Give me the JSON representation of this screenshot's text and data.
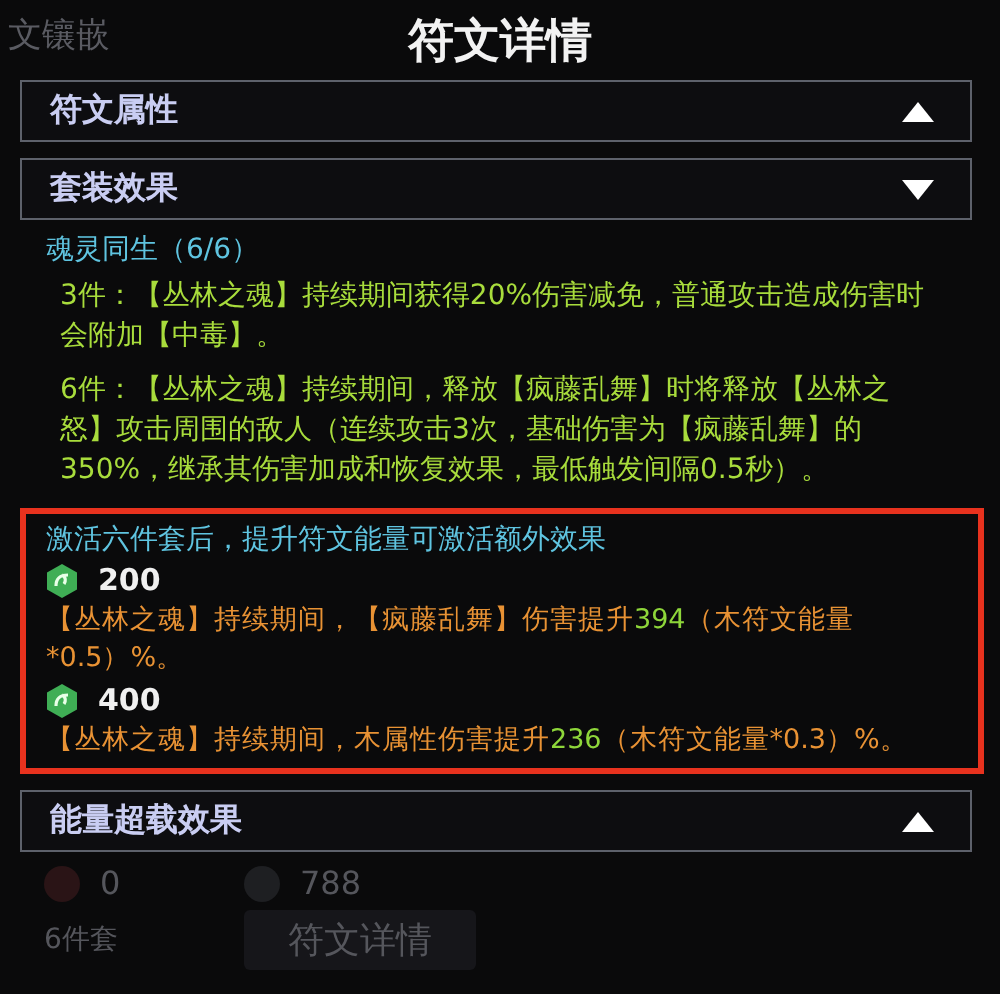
{
  "background": {
    "corner_label": "文镶嵌",
    "stats": [
      {
        "kind": "red",
        "value": "0"
      },
      {
        "kind": "grey",
        "value": "788"
      }
    ],
    "set_count": "6件套",
    "details_button": "符文详情"
  },
  "dialog": {
    "title": "符文详情",
    "sections": [
      {
        "label": "符文属性",
        "expanded": false
      },
      {
        "label": "套装效果",
        "expanded": true,
        "set_name": "魂灵同生（6/6）",
        "effects": [
          {
            "pieces": "3件：",
            "text": "【丛林之魂】持续期间获得20%伤害减免，普通攻击造成伤害时会附加【中毒】。"
          },
          {
            "pieces": "6件：",
            "text": "【丛林之魂】持续期间，释放【疯藤乱舞】时将释放【丛林之怒】攻击周围的敌人（连续攻击3次，基础伤害为【疯藤乱舞】的350%，继承其伤害加成和恢复效果，最低触发间隔0.5秒）。"
          }
        ],
        "highlighted": {
          "heading": "激活六件套后，提升符文能量可激活额外效果",
          "tiers": [
            {
              "energy": "200",
              "segments": [
                {
                  "text": "【丛林之魂】持续期间，【疯藤乱舞】伤害提升",
                  "number": false
                },
                {
                  "text": "394",
                  "number": true
                },
                {
                  "text": "（木符文能量*0.5）%。",
                  "number": false
                }
              ]
            },
            {
              "energy": "400",
              "segments": [
                {
                  "text": "【丛林之魂】持续期间，木属性伤害提升",
                  "number": false
                },
                {
                  "text": "236",
                  "number": true
                },
                {
                  "text": "（木符文能量*0.3）%。",
                  "number": false
                }
              ]
            }
          ]
        }
      },
      {
        "label": "能量超载效果",
        "expanded": false
      }
    ]
  }
}
